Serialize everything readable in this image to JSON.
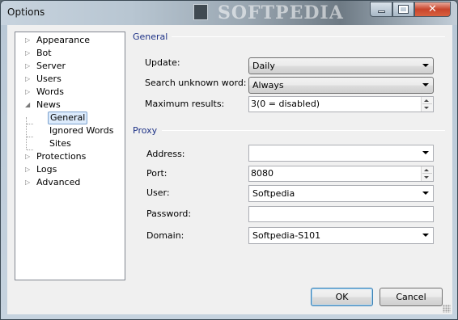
{
  "window": {
    "title": "Options",
    "watermark": "SOFTPEDIA"
  },
  "tree": {
    "items": [
      {
        "label": "Appearance",
        "expander": "▷"
      },
      {
        "label": "Bot",
        "expander": "▷"
      },
      {
        "label": "Server",
        "expander": "▷"
      },
      {
        "label": "Users",
        "expander": "▷"
      },
      {
        "label": "Words",
        "expander": "▷"
      },
      {
        "label": "News",
        "expander": "◢"
      },
      {
        "label": "General",
        "selected": true
      },
      {
        "label": "Ignored Words"
      },
      {
        "label": "Sites"
      },
      {
        "label": "Protections",
        "expander": "▷"
      },
      {
        "label": "Logs",
        "expander": "▷"
      },
      {
        "label": "Advanced",
        "expander": "▷"
      }
    ]
  },
  "general": {
    "title": "General",
    "update_label": "Update:",
    "update_value": "Daily",
    "search_label": "Search unknown word:",
    "search_value": "Always",
    "max_label": "Maximum results:",
    "max_value": "3(0 = disabled)"
  },
  "proxy": {
    "title": "Proxy",
    "address_label": "Address:",
    "address_value": "",
    "port_label": "Port:",
    "port_value": "8080",
    "user_label": "User:",
    "user_value": "Softpedia",
    "password_label": "Password:",
    "password_value": "",
    "domain_label": "Domain:",
    "domain_value": "Softpedia-S101"
  },
  "buttons": {
    "ok": "OK",
    "cancel": "Cancel"
  },
  "icons": {
    "close": "close-icon",
    "minimize": "minimize-icon",
    "maximize": "maximize-icon"
  }
}
